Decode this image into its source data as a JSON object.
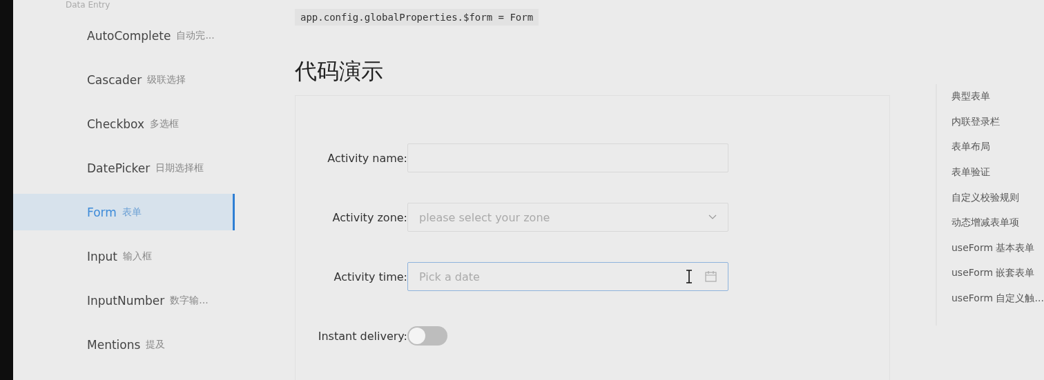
{
  "sidebar": {
    "group_title": "Data Entry",
    "items": [
      {
        "label": "AutoComplete",
        "sublabel": "自动完...",
        "selected": false
      },
      {
        "label": "Cascader",
        "sublabel": "级联选择",
        "selected": false
      },
      {
        "label": "Checkbox",
        "sublabel": "多选框",
        "selected": false
      },
      {
        "label": "DatePicker",
        "sublabel": "日期选择框",
        "selected": false
      },
      {
        "label": "Form",
        "sublabel": "表单",
        "selected": true
      },
      {
        "label": "Input",
        "sublabel": "输入框",
        "selected": false
      },
      {
        "label": "InputNumber",
        "sublabel": "数字输...",
        "selected": false
      },
      {
        "label": "Mentions",
        "sublabel": "提及",
        "selected": false
      }
    ]
  },
  "code_line": "app.config.globalProperties.$form = Form",
  "section_title": "代码演示",
  "form": [
    {
      "kind": "text",
      "label": "Activity name:",
      "focused": false
    },
    {
      "kind": "select",
      "label": "Activity zone:",
      "placeholder": "please select your zone",
      "focused": false
    },
    {
      "kind": "date",
      "label": "Activity time:",
      "placeholder": "Pick a date",
      "focused": true
    },
    {
      "kind": "switch",
      "label": "Instant delivery:",
      "on": false
    }
  ],
  "toc": [
    "典型表单",
    "内联登录栏",
    "表单布局",
    "表单验证",
    "自定义校验规则",
    "动态增减表单项",
    "useForm 基本表单",
    "useForm 嵌套表单",
    "useForm 自定义触..."
  ]
}
